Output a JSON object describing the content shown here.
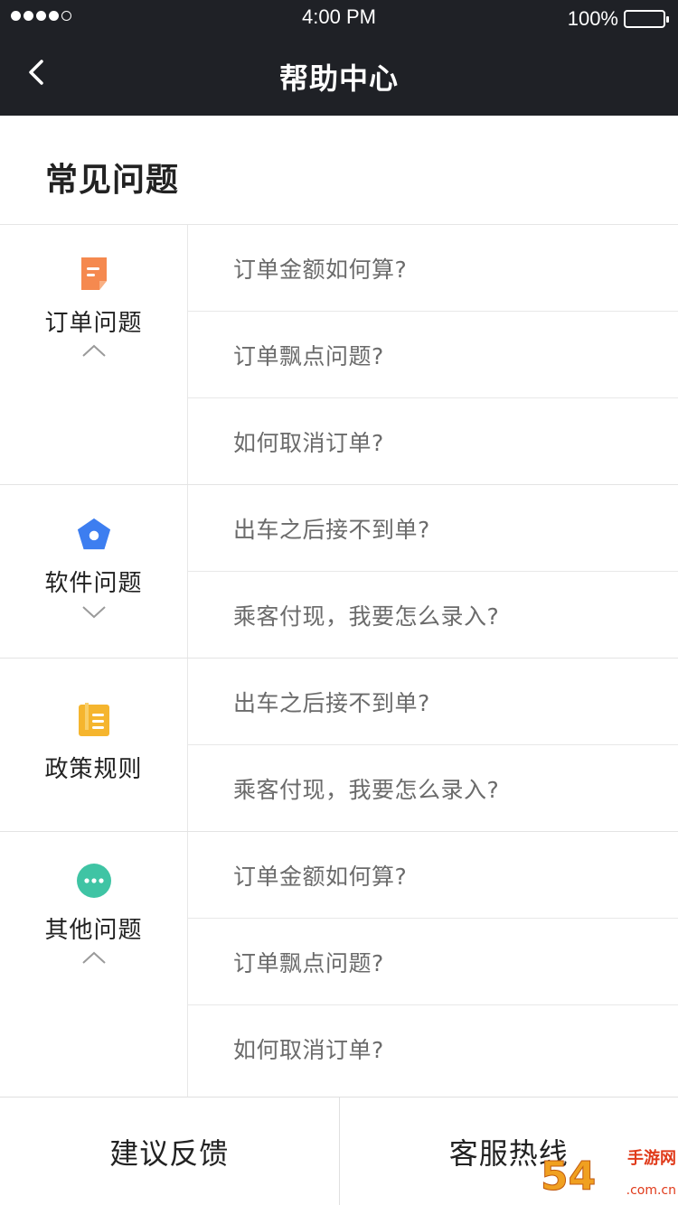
{
  "status_bar": {
    "time": "4:00 PM",
    "battery": "100%"
  },
  "nav": {
    "title": "帮助中心"
  },
  "section": {
    "title": "常见问题"
  },
  "groups": [
    {
      "label": "订单问题",
      "icon": "document-icon",
      "icon_color": "#f5894f",
      "chevron": "up",
      "questions": [
        "订单金额如何算?",
        "订单飘点问题?",
        "如何取消订单?"
      ]
    },
    {
      "label": "软件问题",
      "icon": "pentagon-icon",
      "icon_color": "#3d7ef0",
      "chevron": "down",
      "questions": [
        "出车之后接不到单?",
        "乘客付现，我要怎么录入?"
      ]
    },
    {
      "label": "政策规则",
      "icon": "clipboard-icon",
      "icon_color": "#f5b52e",
      "chevron": "none",
      "questions": [
        "出车之后接不到单?",
        "乘客付现，我要怎么录入?"
      ]
    },
    {
      "label": "其他问题",
      "icon": "more-icon",
      "icon_color": "#3fc4a4",
      "chevron": "up",
      "questions": [
        "订单金额如何算?",
        "订单飘点问题?",
        "如何取消订单?"
      ]
    }
  ],
  "bottom": {
    "feedback": "建议反馈",
    "hotline": "客服热线"
  },
  "watermark": {
    "big": "54",
    "small": "手游网",
    "url": ".com.cn"
  }
}
